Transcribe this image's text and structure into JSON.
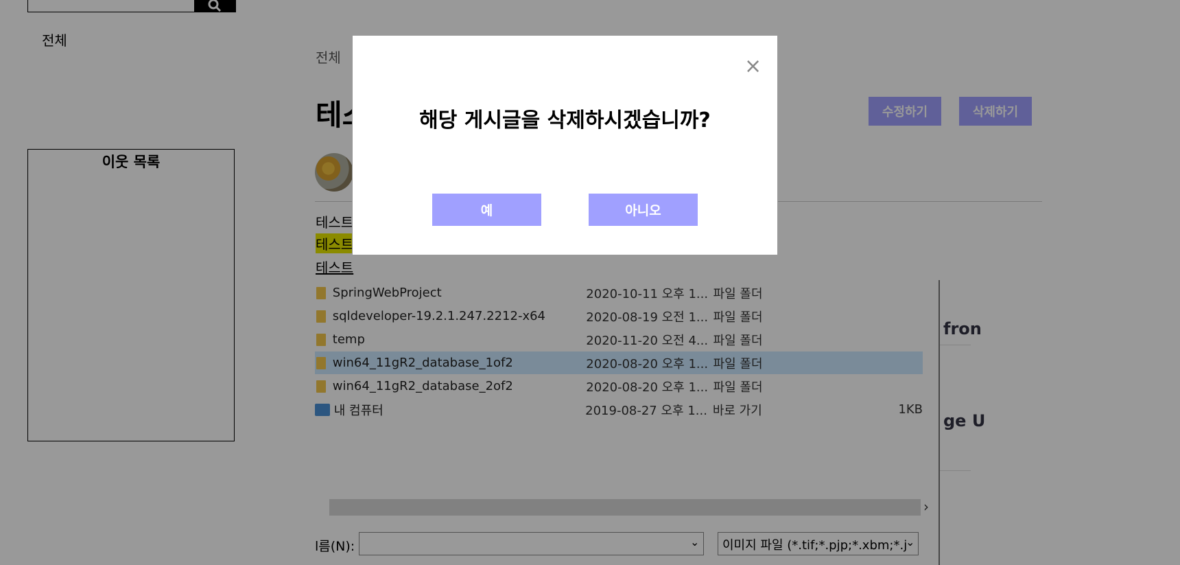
{
  "sidebar": {
    "category_all": "전체",
    "neighbors_title": "이웃 목록"
  },
  "post": {
    "breadcrumb": "전체",
    "title": "테스",
    "edit_label": "수정하기",
    "delete_label": "삭제하기",
    "lines": [
      "테스트",
      "테스트",
      "테스트"
    ]
  },
  "file_dialog": {
    "rows": [
      {
        "name": "SpringWebProject",
        "date": "2020-10-11 오후 1...",
        "type": "파일 폴더",
        "size": "",
        "icon": "folder-icon"
      },
      {
        "name": "sqldeveloper-19.2.1.247.2212-x64",
        "date": "2020-08-19 오전 1...",
        "type": "파일 폴더",
        "size": "",
        "icon": "folder-icon"
      },
      {
        "name": "temp",
        "date": "2020-11-20 오전 4...",
        "type": "파일 폴더",
        "size": "",
        "icon": "folder-icon"
      },
      {
        "name": "win64_11gR2_database_1of2",
        "date": "2020-08-20 오후 1...",
        "type": "파일 폴더",
        "size": "",
        "icon": "folder-icon",
        "selected": true
      },
      {
        "name": "win64_11gR2_database_2of2",
        "date": "2020-08-20 오후 1...",
        "type": "파일 폴더",
        "size": "",
        "icon": "folder-icon"
      },
      {
        "name": "내 컴퓨터",
        "date": "2019-08-27 오후 1...",
        "type": "바로 가기",
        "size": "1KB",
        "icon": "computer-shortcut-icon"
      }
    ],
    "filename_label": "l름(N):",
    "filename_value": "",
    "filetype_value": "이미지 파일 (*.tif;*.pjp;*.xbm;*.j"
  },
  "right_fragments": [
    "fron",
    "ge U"
  ],
  "modal": {
    "close_glyph": "×",
    "message": "해당 게시글을 삭제하시겠습니까?",
    "yes_label": "예",
    "no_label": "아니오"
  },
  "colors": {
    "accent_button": "#a0a0ff",
    "overlay": "rgba(0,0,0,0.4)",
    "highlight": "#e8e800"
  }
}
